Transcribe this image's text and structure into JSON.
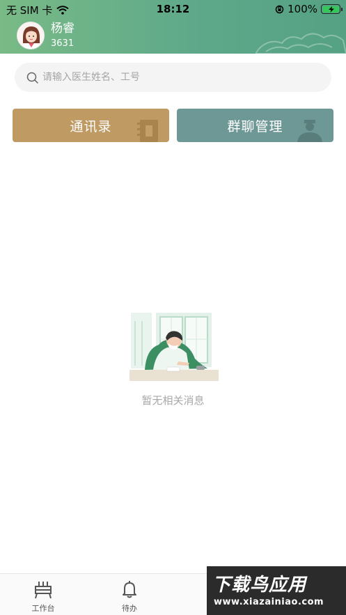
{
  "status_bar": {
    "carrier": "无 SIM 卡",
    "time": "18:12",
    "battery": "100%",
    "battery_level": 1.0
  },
  "profile": {
    "name": "杨睿",
    "id": "3631"
  },
  "search": {
    "placeholder": "请输入医生姓名、工号"
  },
  "actions": {
    "contacts_label": "通讯录",
    "groups_label": "群聊管理"
  },
  "empty_state": {
    "text": "暂无相关消息"
  },
  "tabbar": {
    "items": [
      {
        "label": "工作台",
        "icon": "workbench-icon"
      },
      {
        "label": "待办",
        "icon": "bell-icon"
      }
    ]
  },
  "watermark": {
    "title": "下载鸟应用",
    "url": "www.xiazainiao.com"
  },
  "colors": {
    "header_start": "#79ba86",
    "header_end": "#55a184",
    "contacts_button": "#bf9a62",
    "groups_button": "#6e9896"
  }
}
